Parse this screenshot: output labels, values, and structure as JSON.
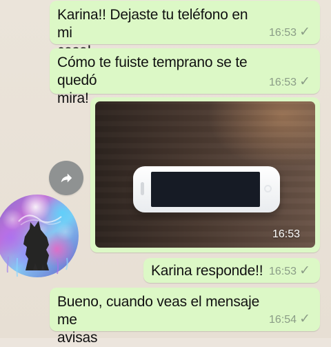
{
  "messages": [
    {
      "text": "Karina!! Dejaste tu teléfono en mi\ncasa!",
      "time": "16:53"
    },
    {
      "text": "Cómo te fuiste temprano se te quedó\nmira!",
      "time": "16:53"
    },
    {
      "type": "image",
      "time": "16:53"
    },
    {
      "text": "Karina responde!!",
      "time": "16:53"
    },
    {
      "text": "Bueno, cuando veas el mensaje me\navisas",
      "time": "16:54"
    }
  ],
  "status_icon": "✓",
  "icons": {
    "forward": "forward-icon",
    "delivered": "check-icon",
    "avatar": "wolf-icon"
  },
  "colors": {
    "background": "#ece5dd",
    "bubble": "#dcf8c6",
    "meta": "#8a9c86"
  }
}
